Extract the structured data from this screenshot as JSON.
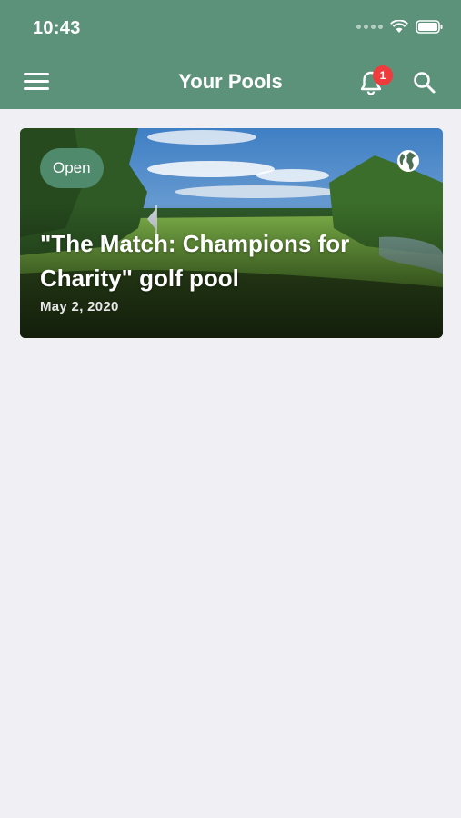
{
  "status_bar": {
    "time": "10:43"
  },
  "nav": {
    "title": "Your Pools",
    "notification_count": "1"
  },
  "pool_card": {
    "status": "Open",
    "title": "\"The Match: Champions for Charity\" golf pool",
    "date": "May 2, 2020"
  },
  "colors": {
    "header": "#5c927a",
    "background": "#efeff4",
    "badge": "#ee3b3b",
    "pill": "#4f8a6d"
  }
}
